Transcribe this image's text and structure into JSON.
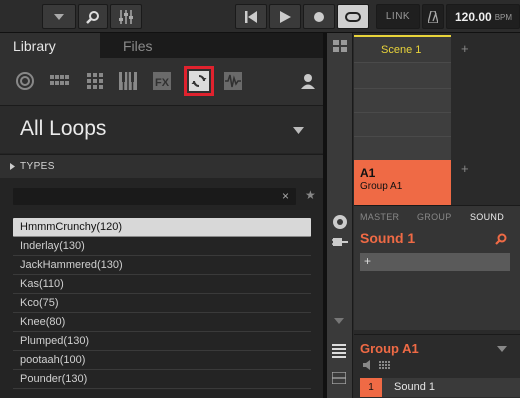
{
  "toolbar": {
    "link_label": "LINK",
    "tempo_value": "120.00",
    "tempo_unit": "BPM"
  },
  "browser": {
    "tabs": [
      {
        "label": "Library"
      },
      {
        "label": "Files"
      }
    ],
    "type_icons": [
      "instrument-icon",
      "kit-icon",
      "groups-icon",
      "samples-icon",
      "fx-icon",
      "loops-icon",
      "one-shots-icon",
      "user-icon"
    ],
    "selected_type": "loops-icon",
    "product": "All Loops",
    "types_label": "TYPES",
    "search_placeholder": "",
    "results": [
      {
        "label": "HmmmCrunchy(120)",
        "selected": true
      },
      {
        "label": "Inderlay(130)"
      },
      {
        "label": "JackHammered(130)"
      },
      {
        "label": "Kas(110)"
      },
      {
        "label": "Kco(75)"
      },
      {
        "label": "Knee(80)"
      },
      {
        "label": "Plumped(130)"
      },
      {
        "label": "pootaah(100)"
      },
      {
        "label": "Pounder(130)"
      }
    ]
  },
  "arranger": {
    "scene": "Scene 1",
    "group_id": "A1",
    "group_name": "Group A1"
  },
  "control": {
    "tabs": [
      "MASTER",
      "GROUP",
      "SOUND"
    ],
    "active_tab": "SOUND",
    "sound_title": "Sound 1",
    "slot_plus": "+"
  },
  "group_panel": {
    "title": "Group A1",
    "slot_number": "1",
    "slot_name": "Sound 1"
  },
  "colors": {
    "accent": "#ef6a45",
    "scene": "#e8d33a",
    "highlight": "#e0222e"
  }
}
